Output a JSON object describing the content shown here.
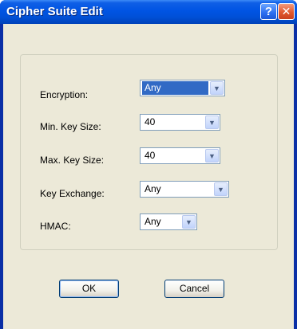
{
  "window": {
    "title": "Cipher Suite Edit",
    "help_glyph": "?",
    "close_glyph": "✕"
  },
  "form": {
    "fields": [
      {
        "label": "Encryption:",
        "value": "Any"
      },
      {
        "label": "Min. Key Size:",
        "value": "40"
      },
      {
        "label": "Max. Key Size:",
        "value": "40"
      },
      {
        "label": "Key Exchange:",
        "value": "Any"
      },
      {
        "label": "HMAC:",
        "value": "Any"
      }
    ]
  },
  "buttons": {
    "ok_label": "OK",
    "cancel_label": "Cancel"
  },
  "icons": {
    "dropdown": "chevron-down-icon",
    "help": "help-icon",
    "close": "close-icon"
  },
  "colors": {
    "titlebar": "#0054e3",
    "dialog_bg": "#ece9d8",
    "selection": "#316ac5",
    "close_button": "#e0582f"
  }
}
